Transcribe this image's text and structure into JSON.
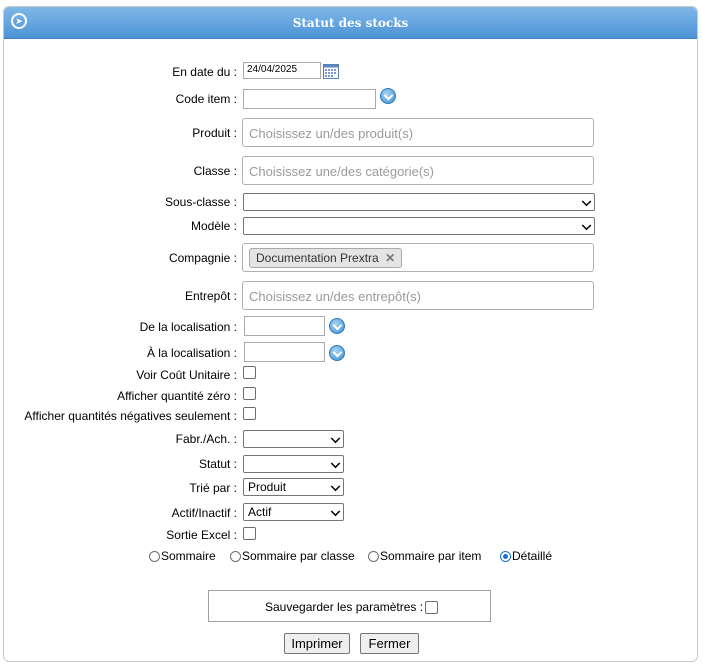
{
  "header": {
    "title": "Statut des stocks",
    "nav_icon": "circle-arrow-right-icon"
  },
  "fields": {
    "date": {
      "label": "En date du :",
      "value": "24/04/2025",
      "icon": "calendar-icon"
    },
    "code_item": {
      "label": "Code item :",
      "value": ""
    },
    "produit": {
      "label": "Produit :",
      "placeholder": "Choisissez un/des produit(s)"
    },
    "classe": {
      "label": "Classe :",
      "placeholder": "Choisissez une/des catégorie(s)"
    },
    "sous_classe": {
      "label": "Sous-classe :",
      "value": ""
    },
    "modele": {
      "label": "Modèle :",
      "value": ""
    },
    "compagnie": {
      "label": "Compagnie :",
      "tag": "Documentation Prextra"
    },
    "entrepot": {
      "label": "Entrepôt :",
      "placeholder": "Choisissez un/des entrepôt(s)"
    },
    "de_localisation": {
      "label": "De la localisation :",
      "value": ""
    },
    "a_localisation": {
      "label": "À la localisation :",
      "value": ""
    },
    "voir_cout": {
      "label": "Voir Coût Unitaire :",
      "checked": false
    },
    "afficher_zero": {
      "label": "Afficher quantité zéro :",
      "checked": false
    },
    "afficher_neg": {
      "label": "Afficher quantités négatives seulement :",
      "checked": false
    },
    "fabr_ach": {
      "label": "Fabr./Ach. :",
      "value": ""
    },
    "statut": {
      "label": "Statut :",
      "value": ""
    },
    "trie_par": {
      "label": "Trié par :",
      "value": "Produit"
    },
    "actif": {
      "label": "Actif/Inactif :",
      "value": "Actif"
    },
    "sortie_excel": {
      "label": "Sortie Excel :",
      "checked": false
    }
  },
  "report_type": {
    "options": [
      "Sommaire",
      "Sommaire par classe",
      "Sommaire par item",
      "Détaillé"
    ],
    "selected": "Détaillé"
  },
  "save_params": {
    "label": "Sauvegarder les paramètres :",
    "checked": false
  },
  "buttons": {
    "print": "Imprimer",
    "close": "Fermer"
  }
}
